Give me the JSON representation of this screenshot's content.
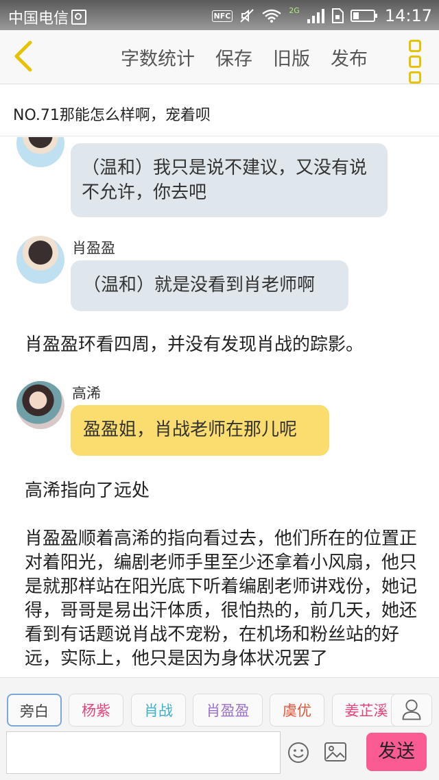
{
  "status_bar": {
    "carrier": "中国电信",
    "nfc": "NFC",
    "network_type": "2G",
    "time": "14:17"
  },
  "toolbar": {
    "word_count_label": "字数统计",
    "save_label": "保存",
    "old_version_label": "旧版",
    "publish_label": "发布",
    "accent_color": "#e6c200"
  },
  "chapter": {
    "title": "NO.71那能怎么样啊，宠着呗"
  },
  "messages": [
    {
      "type": "dialogue",
      "speaker": "",
      "text": "（温和）我只是说不建议，又没有说不允许，你去吧",
      "bubble_color": "#dfe7ec"
    },
    {
      "type": "dialogue",
      "speaker": "肖盈盈",
      "text": "（温和）就是没看到肖老师啊",
      "bubble_color": "#dfe7ec"
    },
    {
      "type": "narration",
      "text": "肖盈盈环看四周，并没有发现肖战的踪影。"
    },
    {
      "type": "dialogue",
      "speaker": "高浠",
      "text": "盈盈姐，肖战老师在那儿呢",
      "bubble_color": "#fbdc6e"
    },
    {
      "type": "narration",
      "text": "高浠指向了远处"
    },
    {
      "type": "narration",
      "text": "肖盈盈顺着高浠的指向看过去，他们所在的位置正对着阳光，编剧老师手里至少还拿着小风扇，他只是就那样站在阳光底下听着编剧老师讲戏份，她记得，哥哥是易出汗体质，很怕热的，前几天，她还看到有话题说肖战不宠粉，在机场和粉丝站的好远，实际上，他只是因为身体状况罢了"
    }
  ],
  "characters": [
    {
      "label": "旁白",
      "color": "#555555"
    },
    {
      "label": "杨紫",
      "color": "#e0457b"
    },
    {
      "label": "肖战",
      "color": "#3bb0c9"
    },
    {
      "label": "肖盈盈",
      "color": "#9b6fc8"
    },
    {
      "label": "虞优",
      "color": "#e2553a"
    },
    {
      "label": "姜芷溪",
      "color": "#e0457b"
    }
  ],
  "input": {
    "placeholder": "",
    "send_label": "发送",
    "send_color": "#fb5b93"
  }
}
